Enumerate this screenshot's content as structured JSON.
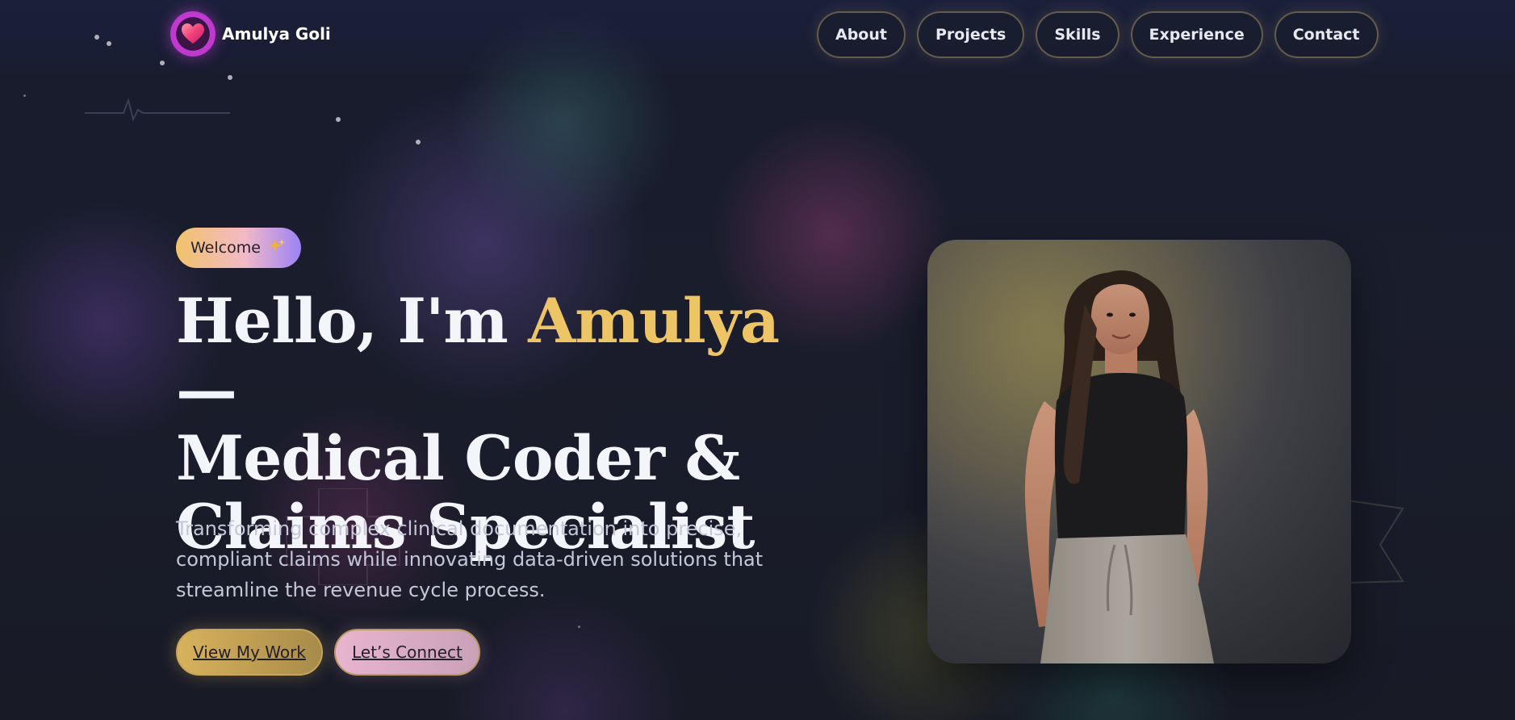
{
  "header": {
    "brand_name": "Amulya Goli",
    "nav": [
      "About",
      "Projects",
      "Skills",
      "Experience",
      "Contact"
    ]
  },
  "hero": {
    "badge_text": "Welcome",
    "badge_icon": "sparkles-icon",
    "title_prefix": "Hello, I'm",
    "title_highlight": "Amulya",
    "title_dash": "—",
    "title_line2": "Medical Coder &",
    "title_line3": "Claims Specialist",
    "subtitle": "Transforming complex clinical documentation into precise, compliant claims while innovating data-driven solutions that streamline the revenue cycle process.",
    "primary_button": "View My Work",
    "secondary_button": "Let’s Connect"
  },
  "colors": {
    "accent_gold": "#eec566",
    "background": "#161826",
    "logo_ring": "#c23bd1",
    "badge_gradient": [
      "#f0c36a",
      "#f3b9c7",
      "#9b83f6"
    ]
  }
}
